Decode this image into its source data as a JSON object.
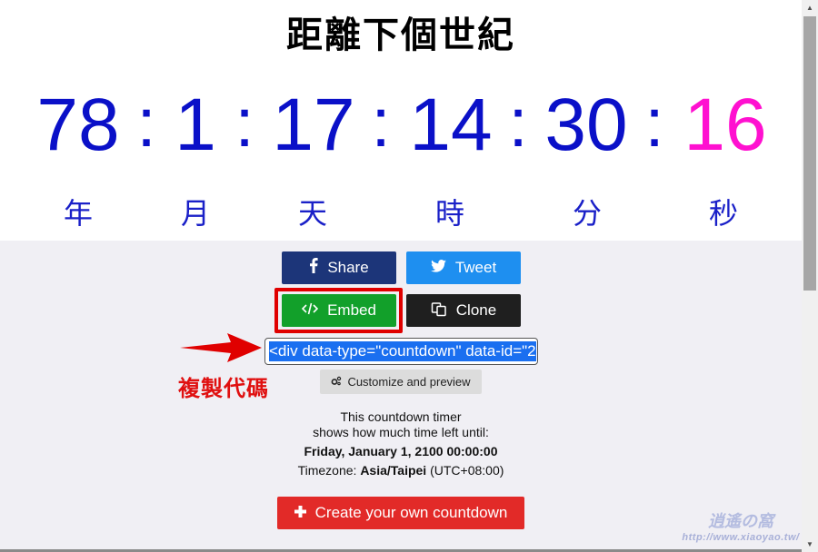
{
  "title": "距離下個世紀",
  "countdown": {
    "years": "78",
    "months": "1",
    "days": "17",
    "hours": "14",
    "minutes": "30",
    "seconds": "16",
    "separator": ":",
    "units": {
      "years": "年",
      "months": "月",
      "days": "天",
      "hours": "時",
      "minutes": "分",
      "seconds": "秒"
    },
    "colors": {
      "digits": "#0a10c8",
      "seconds": "#ff10d0"
    }
  },
  "actions": {
    "share": {
      "label": "Share",
      "icon": "facebook-icon",
      "color": "#1c3579"
    },
    "tweet": {
      "label": "Tweet",
      "icon": "twitter-icon",
      "color": "#1e8ff0"
    },
    "embed": {
      "label": "Embed",
      "icon": "code-icon",
      "color": "#12a02a"
    },
    "clone": {
      "label": "Clone",
      "icon": "copy-icon",
      "color": "#1f1f1f"
    }
  },
  "embed_code": {
    "value": "<div data-type=\"countdown\" data-id=\"2"
  },
  "annotation": {
    "label": "複製代碼",
    "color": "#e01010"
  },
  "customize": {
    "label": "Customize and preview",
    "icon": "gears-icon"
  },
  "info": {
    "line1": "This countdown timer",
    "line2": "shows how much time left until:",
    "target_date": "Friday, January 1, 2100 00:00:00",
    "timezone_prefix": "Timezone:",
    "timezone": "Asia/Taipei",
    "utc_offset": "(UTC+08:00)"
  },
  "create": {
    "label": "Create your own countdown",
    "icon": "plus-icon",
    "color": "#e22a28"
  },
  "watermark": {
    "logo": "逍遙の窩",
    "url": "http://www.xiaoyao.tw/"
  }
}
